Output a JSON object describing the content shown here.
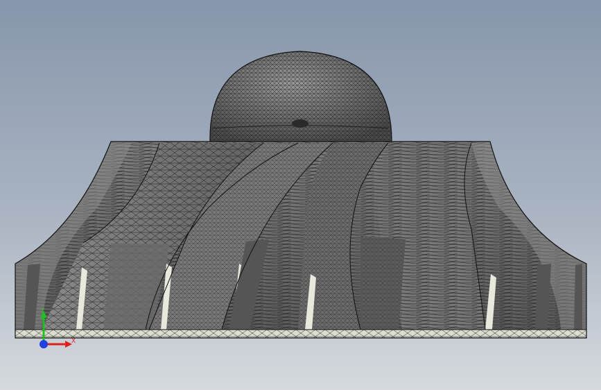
{
  "viewport": {
    "background_top": "#8a9ab0",
    "background_bottom": "#d4d8de",
    "model_face": "#6e6e6e",
    "model_edge": "#111111",
    "model_highlight": "#f2f2e8"
  },
  "triad": {
    "x_label": "X",
    "y_label": "Y",
    "x_color": "#e02020",
    "y_color": "#20c020",
    "z_color": "#2040e0"
  }
}
